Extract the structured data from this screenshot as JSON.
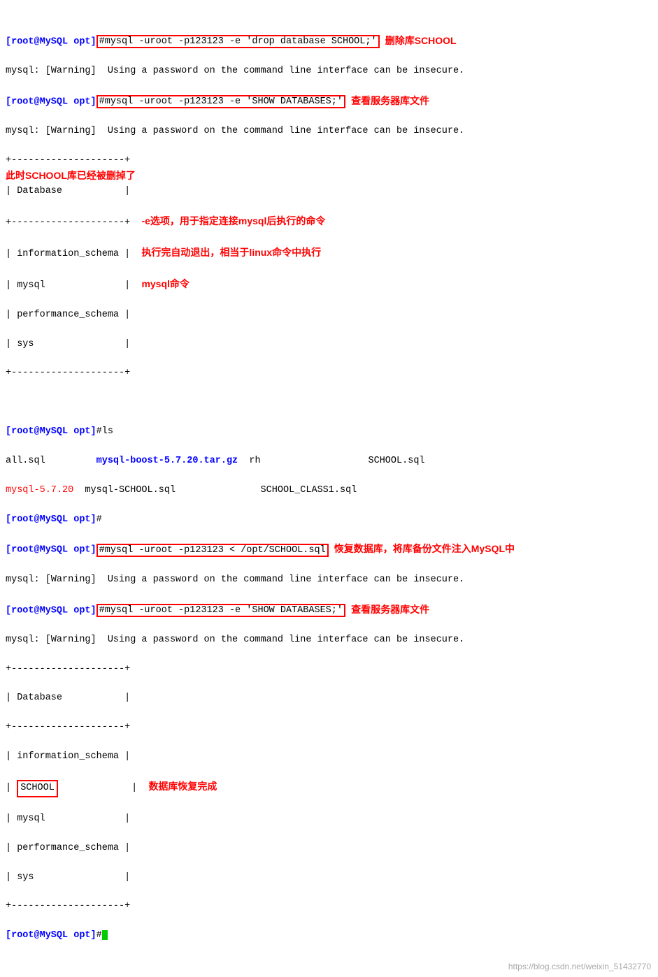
{
  "terminal": {
    "lines": [
      {
        "type": "cmd1"
      },
      {
        "type": "warning1"
      },
      {
        "type": "cmd2"
      },
      {
        "type": "warning2"
      },
      {
        "type": "table_top"
      },
      {
        "type": "db_header"
      },
      {
        "type": "table_sep"
      },
      {
        "type": "db1"
      },
      {
        "type": "db2"
      },
      {
        "type": "db3"
      },
      {
        "type": "db4"
      },
      {
        "type": "table_bot"
      },
      {
        "type": "blank"
      },
      {
        "type": "ls_line"
      },
      {
        "type": "ls_files"
      },
      {
        "type": "ls_files2"
      },
      {
        "type": "prompt_blank"
      },
      {
        "type": "cmd_restore"
      },
      {
        "type": "warning3"
      },
      {
        "type": "cmd3"
      },
      {
        "type": "warning4"
      },
      {
        "type": "table_top2"
      },
      {
        "type": "db_header2"
      },
      {
        "type": "table_sep2"
      },
      {
        "type": "db_info2"
      },
      {
        "type": "db_school"
      },
      {
        "type": "db_mysql2"
      },
      {
        "type": "db_perf2"
      },
      {
        "type": "db_sys2"
      },
      {
        "type": "table_bot2"
      },
      {
        "type": "final_prompt"
      }
    ]
  },
  "watermark": "https://blog.csdn.net/weixin_51432770"
}
